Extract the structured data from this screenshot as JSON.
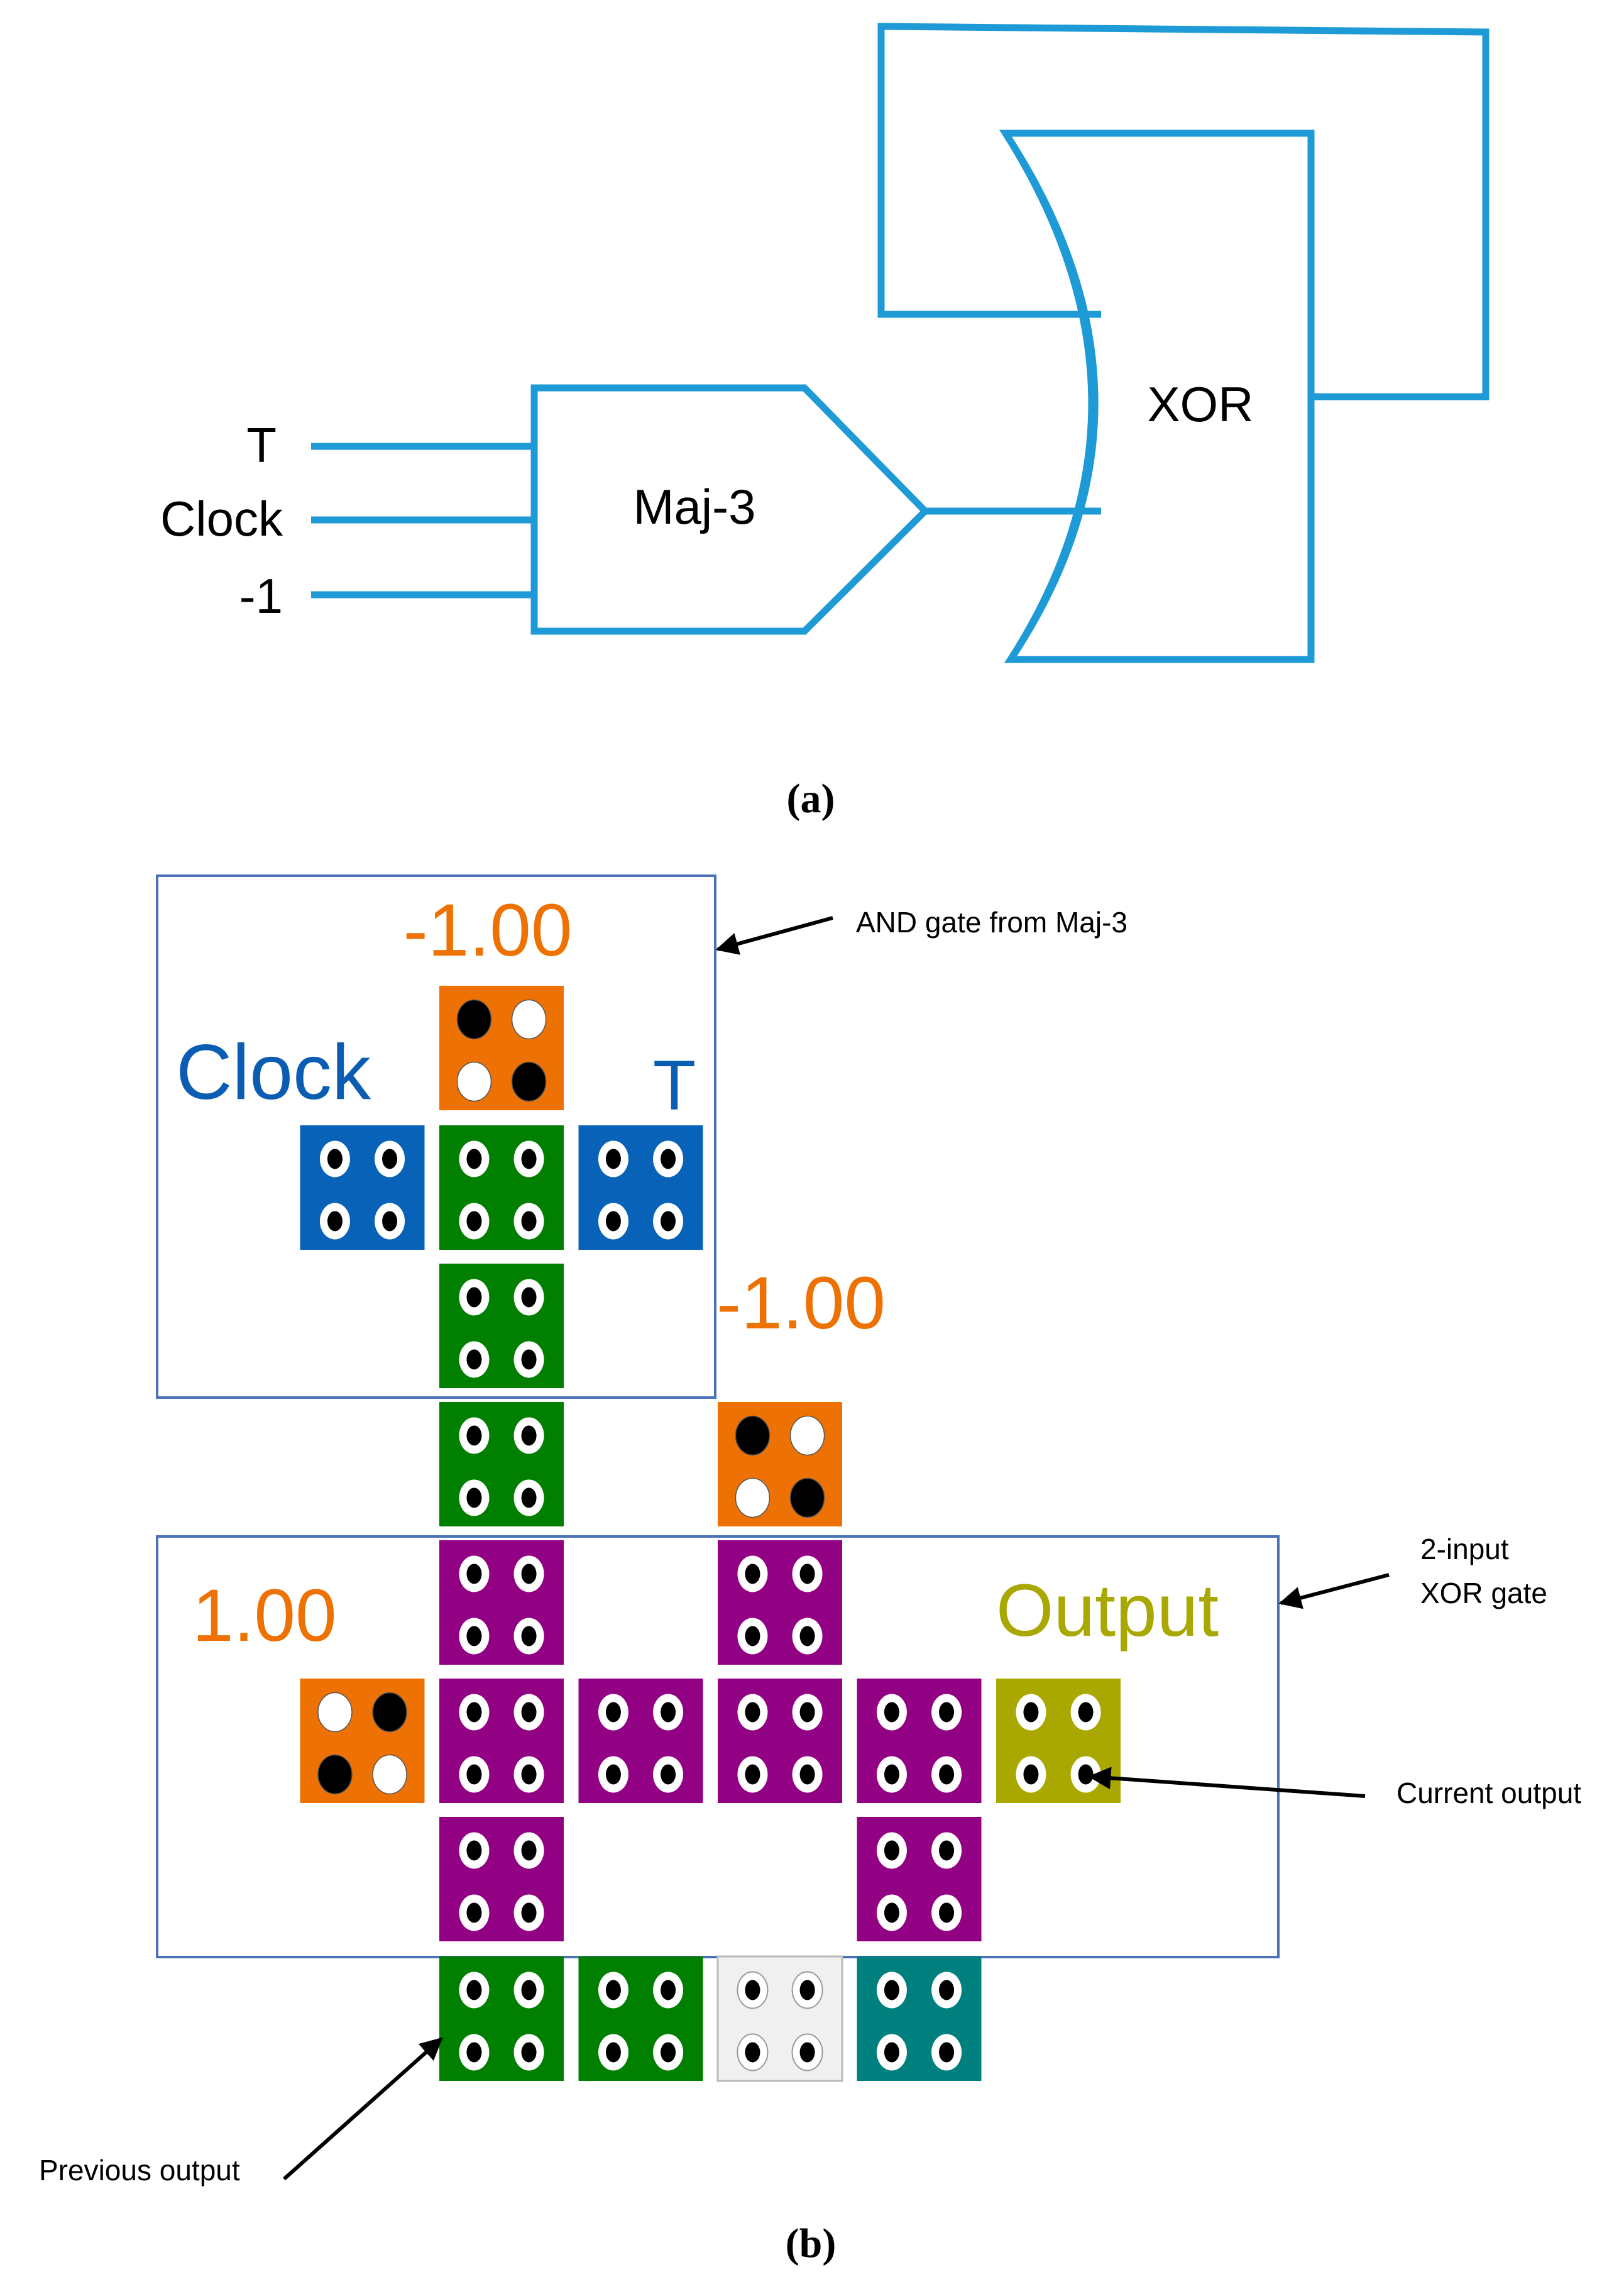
{
  "colors": {
    "wire": "#1e9ad6",
    "frame": "#4a72b8",
    "orange": "#ee7203",
    "green": "#007f00",
    "blue": "#0862b8",
    "purple": "#920083",
    "olive": "#a9a800",
    "teal": "#007f7f",
    "light": "#f0f0f0",
    "clock_label": "#0b5db3",
    "output_label": "#a9a800",
    "value_label": "#ee7203"
  },
  "panel_a": {
    "caption": "(a)",
    "inputs": [
      "T",
      "Clock",
      "-1"
    ],
    "maj_gate_label": "Maj-3",
    "xor_gate_label": "XOR"
  },
  "panel_b": {
    "caption": "(b)",
    "and_box": {
      "clock_label": "Clock",
      "t_label": "T",
      "top_value": "-1.00",
      "side_value": "-1.00"
    },
    "xor_box": {
      "left_value": "1.00",
      "output_label": "Output"
    },
    "annotations": {
      "and_gate": "AND gate from Maj-3",
      "xor_gate_line1": "2-input",
      "xor_gate_line2": "XOR gate",
      "current_output": "Current output",
      "previous_output": "Previous output"
    },
    "tiles": [
      {
        "col": 2,
        "row": 0,
        "color": "orange",
        "kind": "fixed",
        "pattern": "bw-wb"
      },
      {
        "col": 1,
        "row": 1,
        "color": "blue",
        "kind": "cell"
      },
      {
        "col": 2,
        "row": 1,
        "color": "green",
        "kind": "cell"
      },
      {
        "col": 3,
        "row": 1,
        "color": "blue",
        "kind": "cell"
      },
      {
        "col": 2,
        "row": 2,
        "color": "green",
        "kind": "cell"
      },
      {
        "col": 2,
        "row": 3,
        "color": "green",
        "kind": "cell"
      },
      {
        "col": 4,
        "row": 3,
        "color": "orange",
        "kind": "fixed",
        "pattern": "bw-wb"
      },
      {
        "col": 2,
        "row": 4,
        "color": "purple",
        "kind": "cell"
      },
      {
        "col": 4,
        "row": 4,
        "color": "purple",
        "kind": "cell"
      },
      {
        "col": 1,
        "row": 5,
        "color": "orange",
        "kind": "fixed",
        "pattern": "wb-bw"
      },
      {
        "col": 2,
        "row": 5,
        "color": "purple",
        "kind": "cell"
      },
      {
        "col": 3,
        "row": 5,
        "color": "purple",
        "kind": "cell"
      },
      {
        "col": 4,
        "row": 5,
        "color": "purple",
        "kind": "cell"
      },
      {
        "col": 5,
        "row": 5,
        "color": "purple",
        "kind": "cell"
      },
      {
        "col": 6,
        "row": 5,
        "color": "olive",
        "kind": "cell"
      },
      {
        "col": 2,
        "row": 6,
        "color": "purple",
        "kind": "cell"
      },
      {
        "col": 5,
        "row": 6,
        "color": "purple",
        "kind": "cell"
      },
      {
        "col": 2,
        "row": 7,
        "color": "green",
        "kind": "cell"
      },
      {
        "col": 3,
        "row": 7,
        "color": "green",
        "kind": "cell"
      },
      {
        "col": 4,
        "row": 7,
        "color": "light",
        "kind": "cell"
      },
      {
        "col": 5,
        "row": 7,
        "color": "teal",
        "kind": "cell"
      }
    ]
  }
}
